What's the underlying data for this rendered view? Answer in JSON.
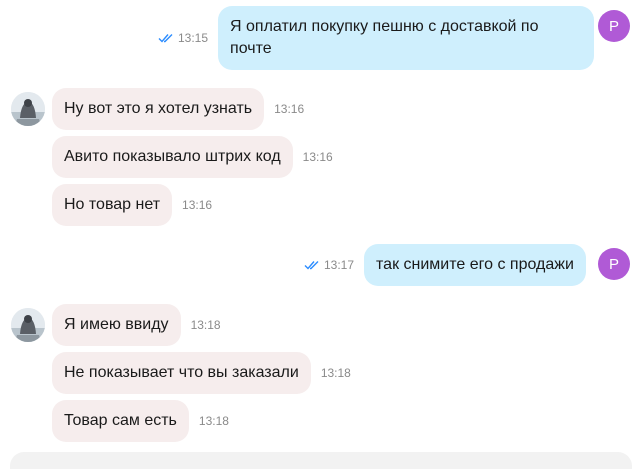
{
  "colors": {
    "incoming_bubble": "#f6eded",
    "outgoing_bubble": "#cfeffd",
    "check_marks": "#2b8cff",
    "avatar_letter_bg": "#b05ad6",
    "timestamp": "#8a8a8a"
  },
  "outgoing_avatar_letter": "P",
  "messages": {
    "m1": {
      "text": "Я оплатил покупку пешню с доставкой по почте",
      "time": "13:15",
      "read_icon": "double-check-icon"
    },
    "m2": {
      "text": "Ну вот это я хотел узнать",
      "time": "13:16"
    },
    "m3": {
      "text": "Авито показывало штрих код",
      "time": "13:16"
    },
    "m4": {
      "text": "Но товар нет",
      "time": "13:16"
    },
    "m5": {
      "text": "так снимите его с продажи",
      "time": "13:17",
      "read_icon": "double-check-icon"
    },
    "m6": {
      "text": "Я имею ввиду",
      "time": "13:18"
    },
    "m7": {
      "text": "Не показывает что вы заказали",
      "time": "13:18"
    },
    "m8": {
      "text": "Товар сам есть",
      "time": "13:18"
    }
  }
}
